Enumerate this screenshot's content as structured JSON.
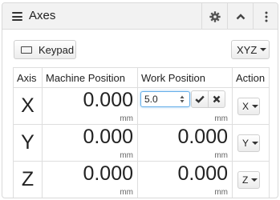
{
  "header": {
    "title": "Axes",
    "buttons": [
      "gear-icon",
      "chevron-up-icon",
      "vertical-ellipsis-icon"
    ]
  },
  "toolbar": {
    "keypad_label": "Keypad",
    "axis_set_label": "XYZ"
  },
  "table": {
    "columns": [
      "Axis",
      "Machine Position",
      "Work Position",
      "Action"
    ],
    "rows": [
      {
        "axis": "X",
        "machine_position": "0.000",
        "machine_unit": "mm",
        "work_position": "",
        "work_input_value": "5.0",
        "work_unit": "mm",
        "action_label": "X"
      },
      {
        "axis": "Y",
        "machine_position": "0.000",
        "machine_unit": "mm",
        "work_position": "0.000",
        "work_unit": "mm",
        "action_label": "Y"
      },
      {
        "axis": "Z",
        "machine_position": "0.000",
        "machine_unit": "mm",
        "work_position": "0.000",
        "work_unit": "mm",
        "action_label": "Z"
      }
    ]
  },
  "colors": {
    "header_bg": "#f2f2f2",
    "input_focus_border": "#66afe9"
  }
}
